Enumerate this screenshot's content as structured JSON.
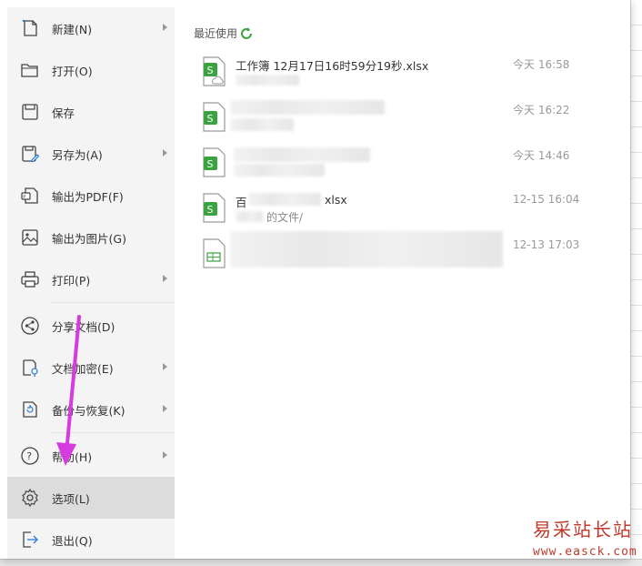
{
  "sidebar": {
    "items": [
      {
        "label": "新建(N)",
        "icon": "new-file-icon",
        "has_submenu": true
      },
      {
        "label": "打开(O)",
        "icon": "folder-open-icon",
        "has_submenu": false
      },
      {
        "label": "保存",
        "icon": "save-icon",
        "has_submenu": false
      },
      {
        "label": "另存为(A)",
        "icon": "save-as-icon",
        "has_submenu": true
      },
      {
        "label": "输出为PDF(F)",
        "icon": "export-pdf-icon",
        "has_submenu": false
      },
      {
        "label": "输出为图片(G)",
        "icon": "export-image-icon",
        "has_submenu": false
      },
      {
        "label": "打印(P)",
        "icon": "printer-icon",
        "has_submenu": true
      },
      {
        "label": "分享文档(D)",
        "icon": "share-icon",
        "has_submenu": false
      },
      {
        "label": "文档加密(E)",
        "icon": "lock-document-icon",
        "has_submenu": true
      },
      {
        "label": "备份与恢复(K)",
        "icon": "backup-restore-icon",
        "has_submenu": true
      },
      {
        "label": "帮助(H)",
        "icon": "help-icon",
        "has_submenu": true
      },
      {
        "label": "选项(L)",
        "icon": "gear-icon",
        "has_submenu": false,
        "active": true
      },
      {
        "label": "退出(Q)",
        "icon": "exit-icon",
        "has_submenu": false
      }
    ]
  },
  "recent": {
    "title": "最近使用",
    "files": [
      {
        "name": "工作簿 12月17日16时59分19秒.xlsx",
        "path": "",
        "time": "今天 16:58",
        "icon": "spreadsheet-cloud-icon"
      },
      {
        "name": "",
        "path": "",
        "time": "今天 16:22",
        "icon": "spreadsheet-icon"
      },
      {
        "name": "",
        "path": "",
        "time": "今天 14:46",
        "icon": "spreadsheet-icon"
      },
      {
        "name": "百",
        "name_suffix": "xlsx",
        "path_prefix": "",
        "path_suffix": "的文件/",
        "time": "12-15 16:04",
        "icon": "spreadsheet-icon"
      },
      {
        "name": "",
        "path": "",
        "time": "12-13 17:03",
        "icon": "spreadsheet-template-icon"
      }
    ]
  },
  "watermark": {
    "title": "易采站长站",
    "url": "www.easck.com"
  },
  "colors": {
    "accent_green": "#3aa33f",
    "arrow_magenta": "#d63be0",
    "watermark_red": "#c0392b",
    "active_bg": "#dcdcdc"
  }
}
